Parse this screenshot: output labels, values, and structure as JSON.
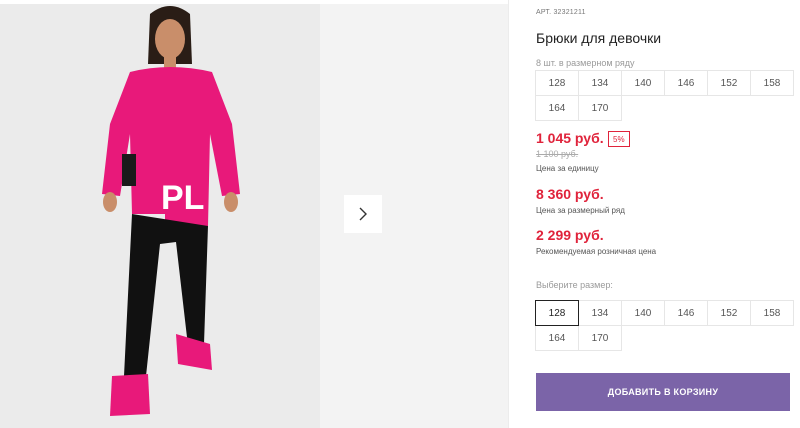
{
  "product": {
    "article_label": "АРТ.",
    "article_number": "32321211",
    "title": "Брюки для девочки",
    "photo_lettering": "PL"
  },
  "pack": {
    "hint": "8 шт. в размерном ряду",
    "sizes": [
      "128",
      "134",
      "140",
      "146",
      "152",
      "158",
      "164",
      "170"
    ]
  },
  "prices": {
    "unit_price": "1 045 руб.",
    "discount_badge": "5%",
    "old_price": "1 100 руб.",
    "unit_label": "Цена за единицу",
    "pack_price": "8 360 руб.",
    "pack_label": "Цена за размерный ряд",
    "retail_price": "2 299 руб.",
    "retail_label": "Рекомендуемая розничная цена"
  },
  "size_select": {
    "hint": "Выберите размер:",
    "selected": "128",
    "sizes": [
      "128",
      "134",
      "140",
      "146",
      "152",
      "158",
      "164",
      "170"
    ]
  },
  "actions": {
    "add_to_cart": "ДОБАВИТЬ В КОРЗИНУ"
  },
  "colors": {
    "price_red": "#e0233b",
    "button_purple": "#7b64a8",
    "sweatshirt_pink": "#e8197a"
  },
  "icons": {
    "next": "chevron-right-icon"
  }
}
